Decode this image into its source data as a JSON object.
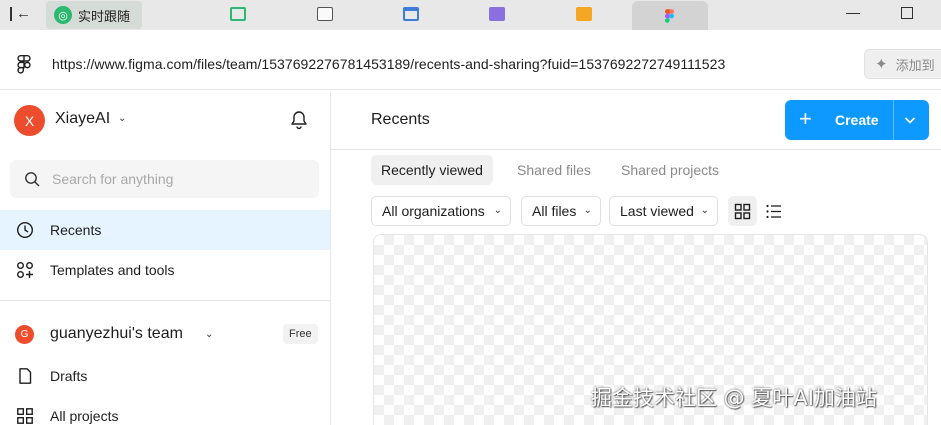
{
  "browser": {
    "tabs": [
      {
        "label": "实时跟随",
        "icon": "green-circle-icon",
        "color": "#2db86f"
      },
      {
        "label": "",
        "icon": "green-window-icon",
        "color": "#2db86f"
      },
      {
        "label": "",
        "icon": "terminal-icon",
        "color": "#555555"
      },
      {
        "label": "",
        "icon": "blue-window-icon",
        "color": "#3b7dd8"
      },
      {
        "label": "",
        "icon": "purple-book-icon",
        "color": "#8b6fe0"
      },
      {
        "label": "",
        "icon": "orange-window-icon",
        "color": "#f5a623"
      },
      {
        "label": "",
        "icon": "figma-icon"
      }
    ],
    "url": "https://www.figma.com/files/team/1537692276781453189/recents-and-sharing?fuid=1537692272749111523",
    "add_button_label": "添加到"
  },
  "sidebar": {
    "user": {
      "avatar_letter": "X",
      "name": "XiayeAI",
      "avatar_color": "#ee4d2d"
    },
    "search": {
      "placeholder": "Search for anything"
    },
    "items": [
      {
        "label": "Recents",
        "icon": "clock-icon",
        "active": true
      },
      {
        "label": "Templates and tools",
        "icon": "templates-icon",
        "active": false
      }
    ],
    "team": {
      "avatar_letter": "G",
      "name": "guanyezhui's team",
      "badge": "Free"
    },
    "team_items": [
      {
        "label": "Drafts",
        "icon": "file-icon"
      },
      {
        "label": "All projects",
        "icon": "grid-icon"
      }
    ]
  },
  "main": {
    "title": "Recents",
    "create_label": "Create",
    "tabs": [
      {
        "label": "Recently viewed",
        "active": true
      },
      {
        "label": "Shared files",
        "active": false
      },
      {
        "label": "Shared projects",
        "active": false
      }
    ],
    "filters": [
      {
        "label": "All organizations"
      },
      {
        "label": "All files"
      },
      {
        "label": "Last viewed"
      }
    ],
    "view_mode": "grid"
  },
  "watermark": "掘金技术社区 @ 夏叶AI加油站",
  "colors": {
    "accent": "#0d99ff",
    "active_bg": "#e5f4ff"
  }
}
